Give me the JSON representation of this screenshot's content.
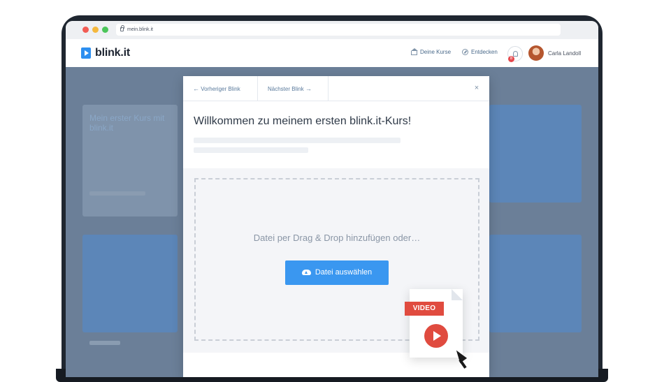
{
  "browser": {
    "url": "mein.blink.it"
  },
  "app": {
    "logo_text": "blink.it",
    "nav": {
      "kurse": "Deine Kurse",
      "entdecken": "Entdecken"
    },
    "notifications_count": "8",
    "user_name": "Carla Landoll"
  },
  "background": {
    "course_title": "Mein erster Kurs mit blink.it"
  },
  "modal": {
    "prev_label": "Vorheriger Blink",
    "next_label": "Nächster Blink",
    "close_glyph": "×",
    "title": "Willkommen zu meinem ersten blink.it-Kurs!",
    "drop_text": "Datei per Drag & Drop hinzufügen oder…",
    "upload_button": "Datei auswählen"
  },
  "video_file": {
    "tag": "VIDEO"
  },
  "colors": {
    "accent": "#3a97f0",
    "video_red": "#e04b3f",
    "backdrop": "#6b7f98"
  }
}
